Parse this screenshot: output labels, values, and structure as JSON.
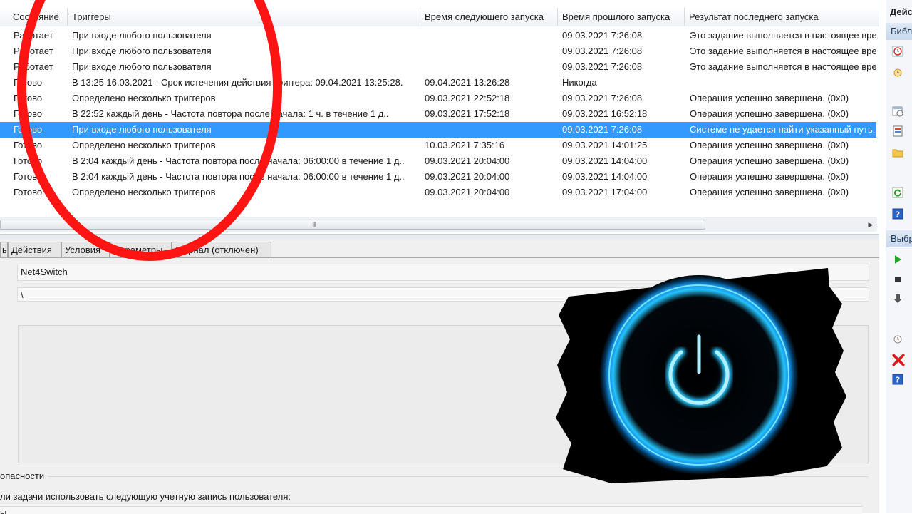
{
  "table": {
    "columns": [
      "Состояние",
      "Триггеры",
      "Время следующего запуска",
      "Время прошлого запуска",
      "Результат последнего запуска"
    ],
    "rows": [
      {
        "status": "Работает",
        "trigger": "При входе любого пользователя",
        "next_run": "",
        "last_run": "09.03.2021 7:26:08",
        "result": "Это задание выполняется в настоящее время.",
        "selected": false
      },
      {
        "status": "Работает",
        "trigger": "При входе любого пользователя",
        "next_run": "",
        "last_run": "09.03.2021 7:26:08",
        "result": "Это задание выполняется в настоящее время.",
        "selected": false
      },
      {
        "status": "Работает",
        "trigger": "При входе любого пользователя",
        "next_run": "",
        "last_run": "09.03.2021 7:26:08",
        "result": "Это задание выполняется в настоящее время.",
        "selected": false
      },
      {
        "status": "Готово",
        "trigger": "В 13:25 16.03.2021 - Срок истечения действия триггера: 09.04.2021 13:25:28.",
        "next_run": "09.04.2021 13:26:28",
        "last_run": "Никогда",
        "result": "",
        "selected": false
      },
      {
        "status": "Готово",
        "trigger": "Определено несколько триггеров",
        "next_run": "09.03.2021 22:52:18",
        "last_run": "09.03.2021 7:26:08",
        "result": "Операция успешно завершена. (0x0)",
        "selected": false
      },
      {
        "status": "Готово",
        "trigger": "В 22:52 каждый день - Частота повтора после начала: 1 ч. в течение 1 д..",
        "next_run": "09.03.2021 17:52:18",
        "last_run": "09.03.2021 16:52:18",
        "result": "Операция успешно завершена. (0x0)",
        "selected": false
      },
      {
        "status": "Готово",
        "trigger": "При входе любого пользователя",
        "next_run": "",
        "last_run": "09.03.2021 7:26:08",
        "result": "Системе не удается найти указанный путь.",
        "selected": true
      },
      {
        "status": "Готово",
        "trigger": "Определено несколько триггеров",
        "next_run": "10.03.2021 7:35:16",
        "last_run": "09.03.2021 14:01:25",
        "result": "Операция успешно завершена. (0x0)",
        "selected": false
      },
      {
        "status": "Готово",
        "trigger": "В 2:04 каждый день - Частота повтора после начала: 06:00:00 в течение 1 д..",
        "next_run": "09.03.2021 20:04:00",
        "last_run": "09.03.2021 14:04:00",
        "result": "Операция успешно завершена. (0x0)",
        "selected": false
      },
      {
        "status": "Готово",
        "trigger": "В 2:04 каждый день - Частота повтора после начала: 06:00:00 в течение 1 д..",
        "next_run": "09.03.2021 20:04:00",
        "last_run": "09.03.2021 14:04:00",
        "result": "Операция успешно завершена. (0x0)",
        "selected": false
      },
      {
        "status": "Готово",
        "trigger": "Определено несколько триггеров",
        "next_run": "09.03.2021 20:04:00",
        "last_run": "09.03.2021 17:04:00",
        "result": "Операция успешно завершена. (0x0)",
        "selected": false
      }
    ],
    "scroll_grip": "III",
    "scroll_right_arrow": "▶"
  },
  "tabs": [
    "ы",
    "Действия",
    "Условия",
    "Параметры",
    "Журнал (отключен)"
  ],
  "details": {
    "name_value": "Net4Switch",
    "location_value": "\\",
    "security_label": "опасности",
    "account_label": "ли задачи использовать следующую учетную запись пользователя:",
    "user_value": "ы"
  },
  "actions": {
    "title": "Действия",
    "section1": "Библиотека планировщика заданий",
    "section2": "Выбранный элемент",
    "icons1": [
      "clock-icon",
      "create-task-icon",
      "import-icon",
      "show-running-icon",
      "history-icon",
      "folder-icon",
      "refresh-icon",
      "help-icon"
    ],
    "icons2": [
      "run-icon",
      "stop-icon",
      "disable-icon",
      "properties-icon",
      "delete-icon",
      "help-icon"
    ]
  },
  "colors": {
    "selection": "#3399ff",
    "annotation_ring": "#ff1414",
    "power_glow": "#27c8ff"
  }
}
